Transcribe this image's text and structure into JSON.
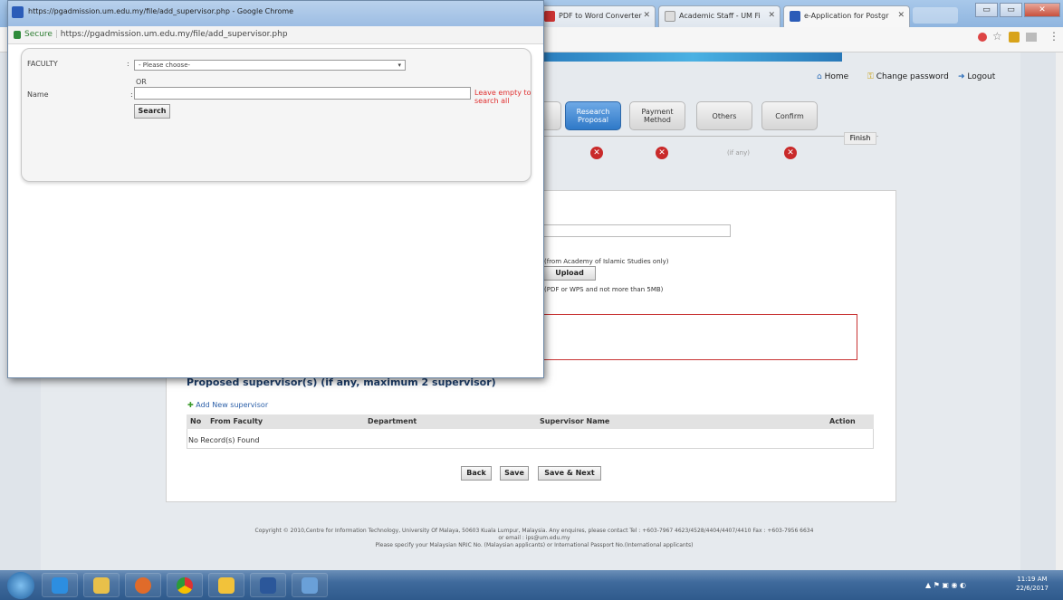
{
  "browser": {
    "tabs": [
      {
        "label": "PDF to Word Converter"
      },
      {
        "label": "Academic Staff - UM Fi"
      },
      {
        "label": "e-Application for Postgr"
      }
    ]
  },
  "header_links": {
    "home": "Home",
    "change_password": "Change password",
    "logout": "Logout"
  },
  "steps": [
    {
      "label": "Research Proposal"
    },
    {
      "label": "Payment Method"
    },
    {
      "label": "Others"
    },
    {
      "label": "Confirm"
    }
  ],
  "finish_label": "Finish",
  "if_any_label": "(if any)",
  "form": {
    "islamic_note": "(from Academy of Islamic Studies only)",
    "upload_button": "Upload",
    "format_note": "(PDF or WPS and not more than 5MB)",
    "supervisor_heading": "Proposed supervisor(s) (if any, maximum 2 supervisor)",
    "add_supervisor": "Add New supervisor",
    "table_headers": [
      "No",
      "From Faculty",
      "Department",
      "Supervisor Name",
      "Action"
    ],
    "empty_row": "No Record(s) Found",
    "buttons": {
      "back": "Back",
      "save": "Save",
      "save_next": "Save & Next"
    }
  },
  "footer": {
    "line1": "Copyright © 2010,Centre for Information Technology, University Of Malaya, 50603 Kuala Lumpur, Malaysia. Any enquires, please contact Tel : +603-7967 4623/4528/4404/4407/4410  Fax : +603-7956 6634",
    "line2": "or email : ips@um.edu.my",
    "line3": "Please specify your Malaysian NRIC No. (Malaysian applicants) or International Passport No.(International applicants)"
  },
  "popup": {
    "title": "https://pgadmission.um.edu.my/file/add_supervisor.php - Google Chrome",
    "secure": "Secure",
    "url": "https://pgadmission.um.edu.my/file/add_supervisor.php",
    "faculty_label": "FACULTY",
    "faculty_select": "- Please choose-",
    "or_label": "OR",
    "name_label": "Name",
    "name_value": "",
    "hint": "Leave empty to search all",
    "search_button": "Search"
  },
  "taskbar": {
    "time": "11:19 AM",
    "date": "22/6/2017"
  }
}
